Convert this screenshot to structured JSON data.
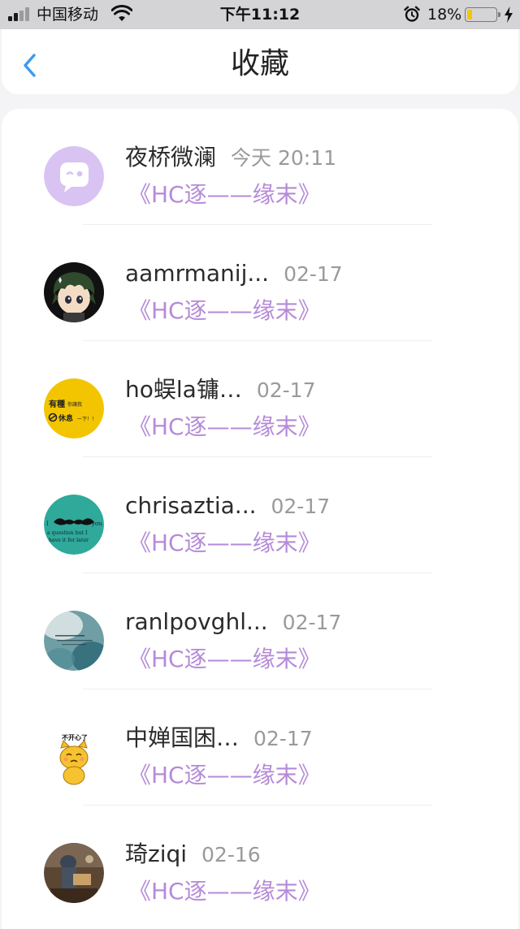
{
  "status_bar": {
    "carrier": "中国移动",
    "time": "下午11:12",
    "battery_percent": "18%",
    "battery_level": 0.18,
    "battery_color": "#f1c40f",
    "icons": [
      "signal-icon",
      "wifi-icon",
      "alarm-icon",
      "battery-icon",
      "charging-icon"
    ]
  },
  "nav": {
    "title": "收藏",
    "back_icon": "chevron-left-icon",
    "accent": "#3b9bf0"
  },
  "favorites": [
    {
      "name": "夜桥微澜",
      "time": "今天 20:11",
      "message": "《HC逐——缘末》"
    },
    {
      "name": "aamrmanij...",
      "time": "02-17",
      "message": "《HC逐——缘末》"
    },
    {
      "name": "ho蜈la镛…",
      "time": "02-17",
      "message": "《HC逐——缘末》"
    },
    {
      "name": "chrisaztia...",
      "time": "02-17",
      "message": "《HC逐——缘末》"
    },
    {
      "name": "ranlpovghl...",
      "time": "02-17",
      "message": "《HC逐——缘末》"
    },
    {
      "name": "中婵国困…",
      "time": "02-17",
      "message": "《HC逐——缘末》"
    },
    {
      "name": "琦ziqi",
      "time": "02-16",
      "message": "《HC逐——缘末》"
    }
  ],
  "avatar_texts": {
    "rest_sign_line1": "有種",
    "rest_sign_line1_small": "你讓我",
    "rest_sign_line2": "休息",
    "rest_sign_line2_small": "一下！！",
    "mustache_line1_left": "I",
    "mustache_line1_right": "you",
    "mustache_line2": "a question but I",
    "mustache_line3": "have it for later",
    "cat_caption": "不开心了"
  },
  "colors": {
    "message_text": "#b58ad8",
    "time_text": "#9a9a9a",
    "default_avatar_bg": "#d9c3f3"
  }
}
